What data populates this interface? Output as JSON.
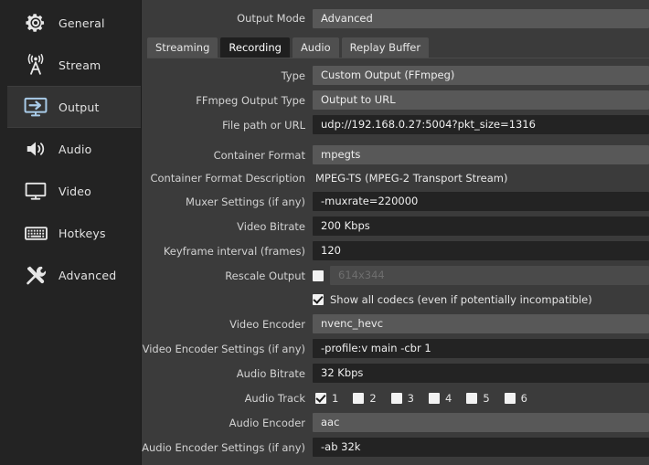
{
  "sidebar": {
    "items": [
      {
        "label": "General",
        "icon": "gear-icon",
        "selected": false
      },
      {
        "label": "Stream",
        "icon": "broadcast-icon",
        "selected": false
      },
      {
        "label": "Output",
        "icon": "output-icon",
        "selected": true
      },
      {
        "label": "Audio",
        "icon": "speaker-icon",
        "selected": false
      },
      {
        "label": "Video",
        "icon": "monitor-icon",
        "selected": false
      },
      {
        "label": "Hotkeys",
        "icon": "keyboard-icon",
        "selected": false
      },
      {
        "label": "Advanced",
        "icon": "tools-icon",
        "selected": false
      }
    ]
  },
  "output_mode": {
    "label": "Output Mode",
    "value": "Advanced"
  },
  "tabs": [
    {
      "label": "Streaming",
      "active": false
    },
    {
      "label": "Recording",
      "active": true
    },
    {
      "label": "Audio",
      "active": false
    },
    {
      "label": "Replay Buffer",
      "active": false
    }
  ],
  "fields": {
    "type": {
      "label": "Type",
      "value": "Custom Output (FFmpeg)"
    },
    "ffmpeg_output_type": {
      "label": "FFmpeg Output Type",
      "value": "Output to URL"
    },
    "file_path_or_url": {
      "label": "File path or URL",
      "value": "udp://192.168.0.27:5004?pkt_size=1316"
    },
    "container_format": {
      "label": "Container Format",
      "value": "mpegts"
    },
    "container_format_description": {
      "label": "Container Format Description",
      "value": "MPEG-TS (MPEG-2 Transport Stream)"
    },
    "muxer_settings": {
      "label": "Muxer Settings (if any)",
      "value": "-muxrate=220000"
    },
    "video_bitrate": {
      "label": "Video Bitrate",
      "value": "200 Kbps"
    },
    "keyframe_interval": {
      "label": "Keyframe interval (frames)",
      "value": "120"
    },
    "rescale_output": {
      "label": "Rescale Output",
      "checked": false,
      "placeholder": "614x344"
    },
    "show_all_codecs": {
      "label": "Show all codecs (even if potentially incompatible)",
      "checked": true
    },
    "video_encoder": {
      "label": "Video Encoder",
      "value": "nvenc_hevc"
    },
    "video_encoder_settings": {
      "label": "Video Encoder Settings (if any)",
      "value": "-profile:v main -cbr 1"
    },
    "audio_bitrate": {
      "label": "Audio Bitrate",
      "value": "32 Kbps"
    },
    "audio_track": {
      "label": "Audio Track",
      "tracks": [
        {
          "num": "1",
          "checked": true
        },
        {
          "num": "2",
          "checked": false
        },
        {
          "num": "3",
          "checked": false
        },
        {
          "num": "4",
          "checked": false
        },
        {
          "num": "5",
          "checked": false
        },
        {
          "num": "6",
          "checked": false
        }
      ]
    },
    "audio_encoder": {
      "label": "Audio Encoder",
      "value": "aac"
    },
    "audio_encoder_settings": {
      "label": "Audio Encoder Settings (if any)",
      "value": "-ab 32k"
    }
  },
  "colors": {
    "window_bg": "#3b3b3b",
    "sidebar_bg": "#232323",
    "combo_bg": "#585858",
    "input_bg": "#232323",
    "accent_icon": "#a9cbe8"
  }
}
